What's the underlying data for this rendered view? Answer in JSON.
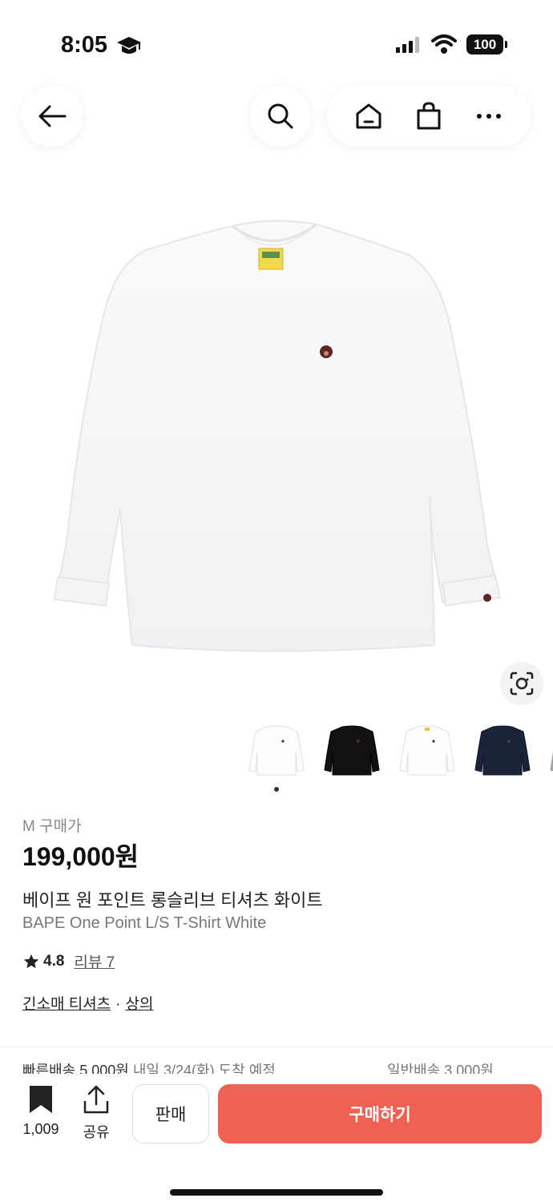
{
  "status_bar": {
    "time": "8:05",
    "battery": "100"
  },
  "product": {
    "size_label": "M 구매가",
    "price": "199,000원",
    "name_ko": "베이프 원 포인트 롱슬리브 티셔츠 화이트",
    "name_en": "BAPE One Point L/S T-Shirt White",
    "rating": "4.8",
    "reviews_label": "리뷰 7",
    "category_primary": "긴소매 티셔츠",
    "category_separator": "·",
    "category_secondary": "상의"
  },
  "thumbnails": [
    {
      "color": "#ffffff",
      "name": "white"
    },
    {
      "color": "#111111",
      "name": "black"
    },
    {
      "color": "#ffffff",
      "name": "white-2"
    },
    {
      "color": "#1b2338",
      "name": "navy"
    },
    {
      "color": "#a8a8a8",
      "name": "gray"
    }
  ],
  "shipping": {
    "fast": "빠른배송 5,000원",
    "eta": "내일 3/24(화) 도착 예정",
    "normal": "일반배송 3,000원"
  },
  "bottom_bar": {
    "bookmark_count": "1,009",
    "share_label": "공유",
    "sell_label": "판매",
    "buy_label": "구매하기"
  },
  "colors": {
    "accent": "#ef6253",
    "shirt": "#ffffff"
  }
}
